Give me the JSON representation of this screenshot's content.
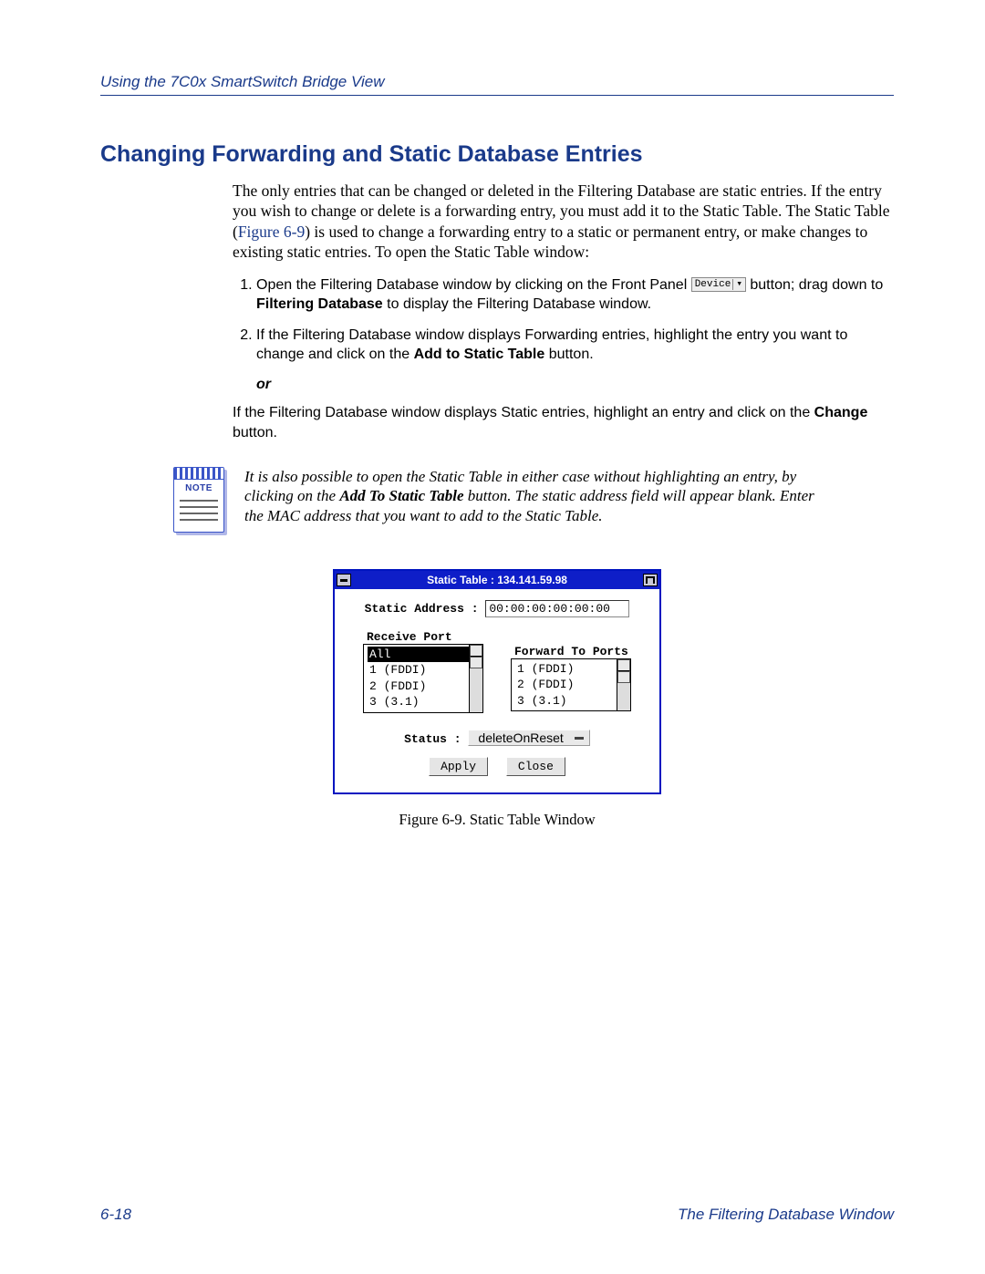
{
  "header": {
    "title": "Using the 7C0x SmartSwitch Bridge View"
  },
  "section": {
    "heading": "Changing Forwarding and Static Database Entries"
  },
  "intro": {
    "p1a": "The only entries that can be changed or deleted in the Filtering Database are static entries. If the entry you wish to change or delete is a forwarding entry, you must add it to the Static Table. The Static Table (",
    "figref": "Figure 6-9",
    "p1b": ") is used to change a forwarding entry to a static or permanent entry, or make changes to existing static entries. To open the Static Table window:"
  },
  "device_button_label": "Device",
  "steps": {
    "s1a": "Open the Filtering Database window by clicking on the Front Panel ",
    "s1b": " button; drag down to ",
    "s1bold": "Filtering Database",
    "s1c": " to display the Filtering Database window.",
    "s2a": "If the Filtering Database window displays Forwarding entries, highlight the entry you want to change and click on the ",
    "s2bold": "Add to Static Table",
    "s2b": " button.",
    "or": "or",
    "s3a": "If the Filtering Database window displays Static entries, highlight an entry and click on the ",
    "s3bold": "Change",
    "s3b": " button."
  },
  "note": {
    "label": "NOTE",
    "t1": "It is also possible to open the Static Table in either case without highlighting an entry, by clicking on the ",
    "bold": "Add To Static Table",
    "t2": " button. The static address field will appear blank. Enter the MAC address that you want to add to the Static Table."
  },
  "window": {
    "title": "Static Table : 134.141.59.98",
    "static_address_label": "Static Address :",
    "static_address_value": "00:00:00:00:00:00",
    "receive_port_label": "Receive Port",
    "forward_to_ports_label": "Forward To Ports",
    "receive_ports": [
      "All",
      "1  (FDDI)",
      "2  (FDDI)",
      "3  (3.1)"
    ],
    "forward_ports": [
      "1  (FDDI)",
      "2  (FDDI)",
      "3  (3.1)"
    ],
    "status_label": "Status :",
    "status_value": "deleteOnReset",
    "apply": "Apply",
    "close": "Close"
  },
  "figure_caption": "Figure 6-9. Static Table Window",
  "footer": {
    "page": "6-18",
    "section": "The Filtering Database Window"
  }
}
